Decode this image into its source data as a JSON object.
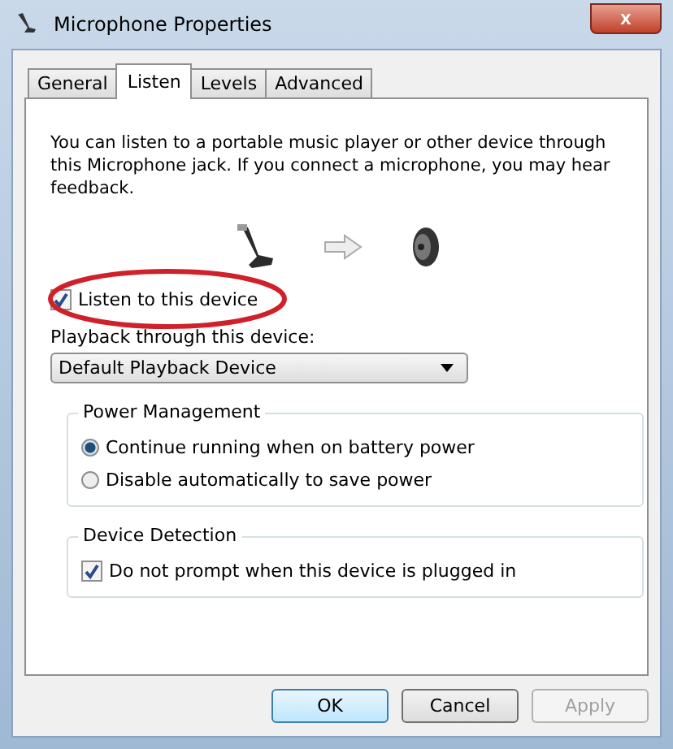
{
  "window": {
    "title": "Microphone Properties",
    "close": "x"
  },
  "tabs": [
    {
      "label": "General",
      "selected": false
    },
    {
      "label": "Listen",
      "selected": true
    },
    {
      "label": "Levels",
      "selected": false
    },
    {
      "label": "Advanced",
      "selected": false
    }
  ],
  "description": "You can listen to a portable music player or other device through this Microphone jack.  If you connect a microphone, you may hear feedback.",
  "listen_checkbox": {
    "label": "Listen to this device",
    "checked": true
  },
  "playback": {
    "label": "Playback through this device:",
    "value": "Default Playback Device"
  },
  "groups": [
    {
      "title": "Power Management",
      "options": [
        {
          "kind": "radio",
          "label": "Continue running when on battery power",
          "selected": true
        },
        {
          "kind": "radio",
          "label": "Disable automatically to save power",
          "selected": false
        }
      ]
    },
    {
      "title": "Device Detection",
      "options": [
        {
          "kind": "checkbox",
          "label": "Do not prompt when this device is plugged in",
          "checked": true
        }
      ]
    }
  ],
  "buttons": [
    {
      "label": "OK",
      "default": true,
      "disabled": false
    },
    {
      "label": "Cancel",
      "default": false,
      "disabled": false
    },
    {
      "label": "Apply",
      "default": false,
      "disabled": true
    }
  ]
}
